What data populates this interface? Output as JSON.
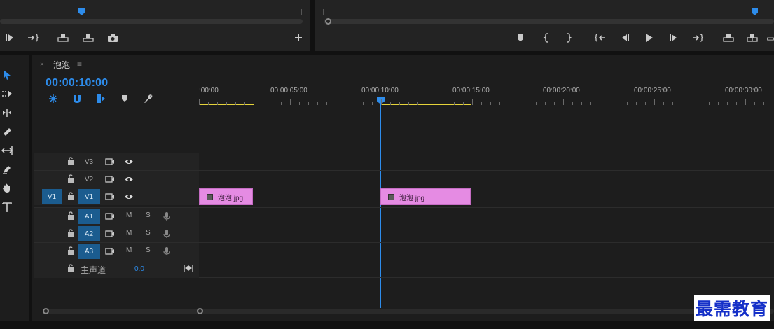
{
  "source_monitor": {
    "name": "source-monitor"
  },
  "program_monitor": {
    "name": "program-monitor"
  },
  "timeline": {
    "tab": {
      "close": "×",
      "title": "泡泡",
      "menu": "≡"
    },
    "timecode": "00:00:10:00",
    "ruler_labels": [
      ":00:00",
      "00:00:05:00",
      "00:00:10:00",
      "00:00:15:00",
      "00:00:20:00",
      "00:00:25:00",
      "00:00:30:00"
    ],
    "video_tracks": [
      {
        "name": "V3",
        "active": false,
        "source": ""
      },
      {
        "name": "V2",
        "active": false,
        "source": ""
      },
      {
        "name": "V1",
        "active": true,
        "source": "V1"
      }
    ],
    "audio_tracks": [
      {
        "name": "A1",
        "m": "M",
        "s": "S"
      },
      {
        "name": "A2",
        "m": "M",
        "s": "S"
      },
      {
        "name": "A3",
        "m": "M",
        "s": "S"
      }
    ],
    "master": {
      "label": "主声道",
      "value": "0.0"
    },
    "clips": [
      {
        "label": "泡泡.jpg"
      },
      {
        "label": "泡泡.jpg"
      }
    ]
  },
  "watermark": "最需教育",
  "colors": {
    "accent": "#2d8ceb",
    "clip": "#e58be3",
    "workarea": "#e5d33a",
    "patch": "#1b5c8f"
  }
}
